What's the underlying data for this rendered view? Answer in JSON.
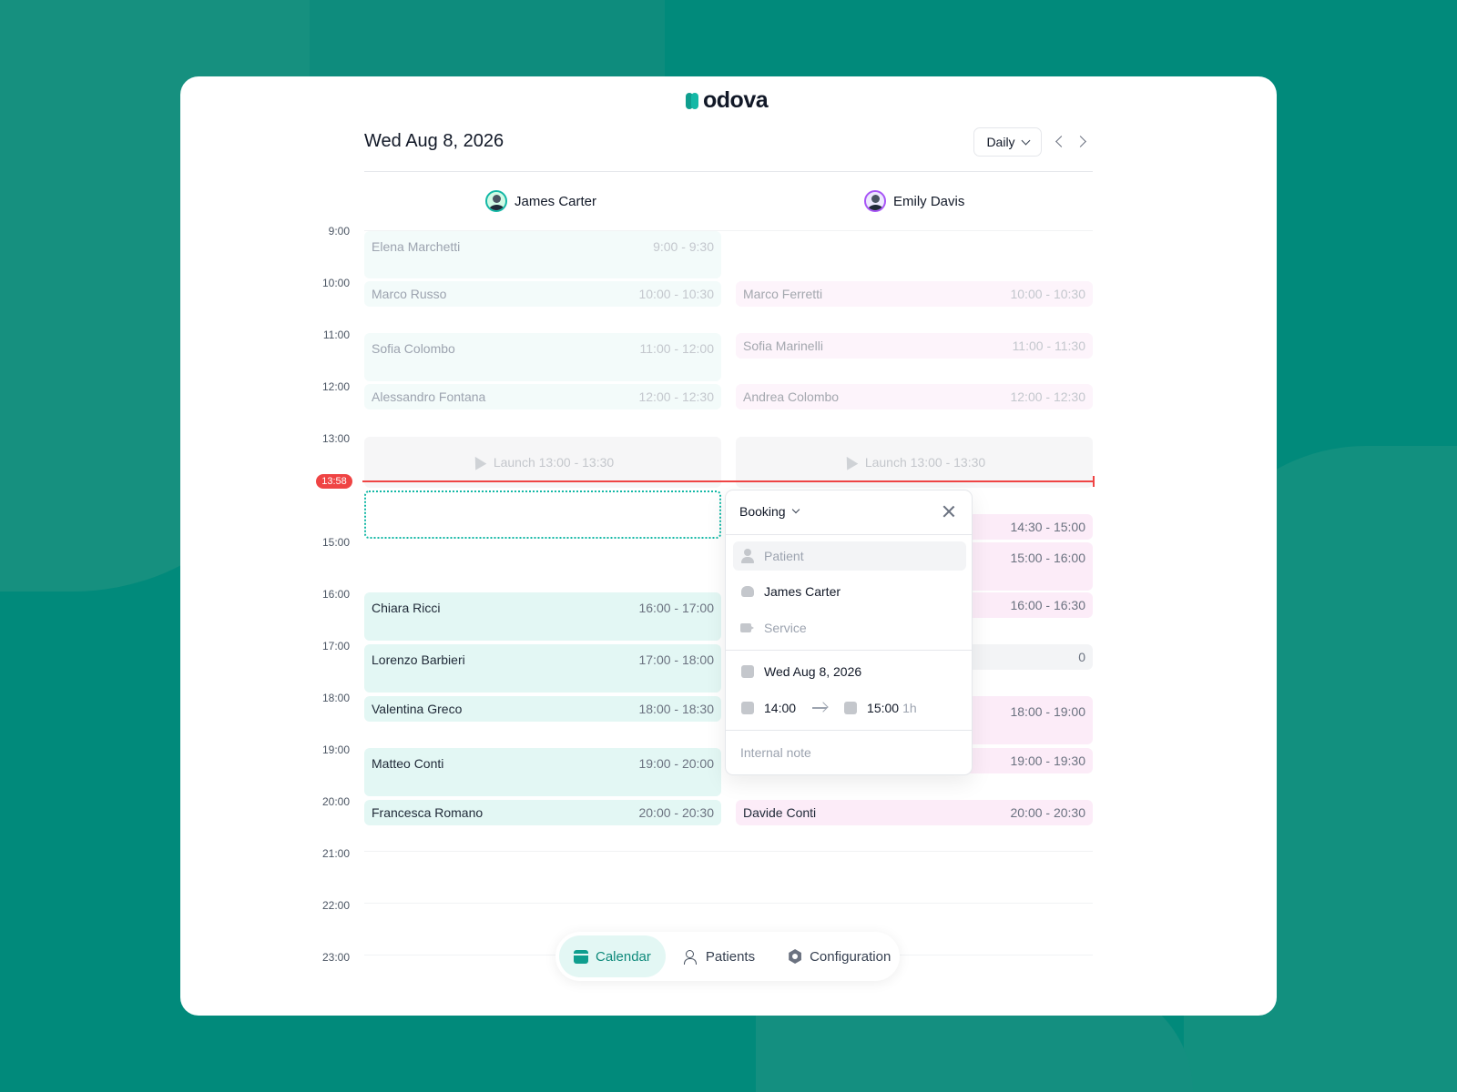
{
  "brand": {
    "name": "odova",
    "accent": "#14b8a6",
    "background": "#018a7b"
  },
  "header": {
    "date": "Wed Aug 8, 2026",
    "view": "Daily"
  },
  "doctors": [
    {
      "name": "James Carter"
    },
    {
      "name": "Emily Davis"
    }
  ],
  "hours": [
    "9:00",
    "10:00",
    "11:00",
    "12:00",
    "13:00",
    "14:00",
    "15:00",
    "16:00",
    "17:00",
    "18:00",
    "19:00",
    "20:00",
    "21:00",
    "22:00",
    "23:00"
  ],
  "now": "13:58",
  "james_appointments": [
    {
      "name": "Elena Marchetti",
      "time": "9:00 - 9:30"
    },
    {
      "name": "Marco Russo",
      "time": "10:00 - 10:30"
    },
    {
      "name": "Sofia Colombo",
      "time": "11:00 - 12:00"
    },
    {
      "name": "Alessandro Fontana",
      "time": "12:00 - 12:30"
    },
    {
      "name": "Chiara Ricci",
      "time": "16:00 - 17:00"
    },
    {
      "name": "Lorenzo Barbieri",
      "time": "17:00 - 18:00"
    },
    {
      "name": "Valentina Greco",
      "time": "18:00 - 18:30"
    },
    {
      "name": "Matteo Conti",
      "time": "19:00 - 20:00"
    },
    {
      "name": "Francesca Romano",
      "time": "20:00 - 20:30"
    }
  ],
  "emily_appointments": [
    {
      "name": "Marco Ferretti",
      "time": "10:00 - 10:30"
    },
    {
      "name": "Sofia Marinelli",
      "time": "11:00 - 11:30"
    },
    {
      "name": "Andrea Colombo",
      "time": "12:00 - 12:30"
    },
    {
      "name": "",
      "time": "14:30 - 15:00"
    },
    {
      "name": "",
      "time": "15:00 - 16:00"
    },
    {
      "name": "",
      "time": "16:00 - 16:30"
    },
    {
      "name": "",
      "time": "0"
    },
    {
      "name": "",
      "time": "18:00 - 19:00"
    },
    {
      "name": "",
      "time": "19:00 - 19:30"
    },
    {
      "name": "Davide Conti",
      "time": "20:00 - 20:30"
    }
  ],
  "lunch": {
    "label": "Launch 13:00 - 13:30"
  },
  "booking": {
    "title": "Booking",
    "patient_placeholder": "Patient",
    "doctor": "James Carter",
    "service_placeholder": "Service",
    "date": "Wed Aug 8, 2026",
    "start": "14:00",
    "end": "15:00",
    "duration": "1h",
    "note_placeholder": "Internal note"
  },
  "nav": {
    "calendar": "Calendar",
    "patients": "Patients",
    "configuration": "Configuration"
  }
}
